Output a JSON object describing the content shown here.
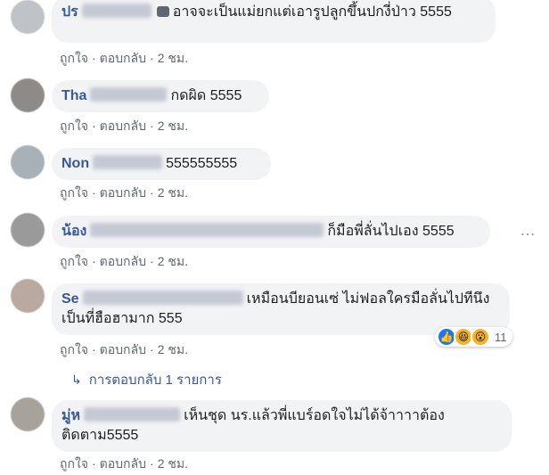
{
  "comments": [
    {
      "author_visible": "ปร",
      "text": "อาจจะเป็นแม่ยกแต่เอารูปลูกขึ้นปกงี่ป่าว 5555",
      "like": "ถูกใจ",
      "reply": "ตอบกลับ",
      "time": "2 ชม."
    },
    {
      "author_visible": "Tha",
      "text": "กดผิด 5555",
      "like": "ถูกใจ",
      "reply": "ตอบกลับ",
      "time": "2 ชม."
    },
    {
      "author_visible": "Non",
      "text": "555555555",
      "like": "ถูกใจ",
      "reply": "ตอบกลับ",
      "time": "2 ชม."
    },
    {
      "author_visible": "น้อง",
      "text": "ก็มือพี่ลั่นไปเอง 5555",
      "like": "ถูกใจ",
      "reply": "ตอบกลับ",
      "time": "2 ชม."
    },
    {
      "author_visible": "Se",
      "text": "เหมือนบียอนเซ่ ไม่ฟอลใครมือลั่นไปทีนึง เป็นที่ฮือฮามาก 555",
      "like": "ถูกใจ",
      "reply": "ตอบกลับ",
      "time": "2 ชม.",
      "reaction_count": "11",
      "replies_link": "การตอบกลับ 1 รายการ"
    },
    {
      "author_visible": "มู่ห",
      "text": "เห็นชุด นร.แล้วพี่แบร์อดใจไม่ได้จ้าาาาต้องติดตาม5555",
      "like": "ถูกใจ",
      "reply": "ตอบกลับ",
      "time": "2 ชม."
    }
  ],
  "more_icon": "…",
  "colors": {
    "bubble": "#f2f3f5",
    "author": "#385898",
    "meta": "#606770"
  }
}
